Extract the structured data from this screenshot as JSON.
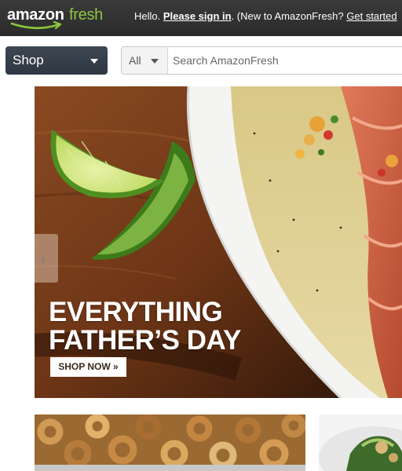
{
  "header": {
    "logo_word_amazon": "amazon",
    "logo_word_fresh": "fresh",
    "greeting_hello": "Hello. ",
    "greeting_signin": "Please sign in",
    "greeting_period": ".",
    "greeting_new": "  (New to AmazonFresh? ",
    "greeting_started": "Get started"
  },
  "nav": {
    "shop_label": "Shop",
    "search_category": "All",
    "search_placeholder": "Search AmazonFresh"
  },
  "hero": {
    "headline_line1": "EVERYTHING",
    "headline_line2": "FATHER’S DAY",
    "cta_label": "SHOP NOW »",
    "prev_glyph": "‹"
  },
  "colors": {
    "topbar": "#2f2f2f",
    "fresh_green": "#8dc63f",
    "shop_button": "#36404b"
  },
  "icons": [
    "amazon-smile-logo",
    "caret-down-icon",
    "chevron-left-icon"
  ]
}
